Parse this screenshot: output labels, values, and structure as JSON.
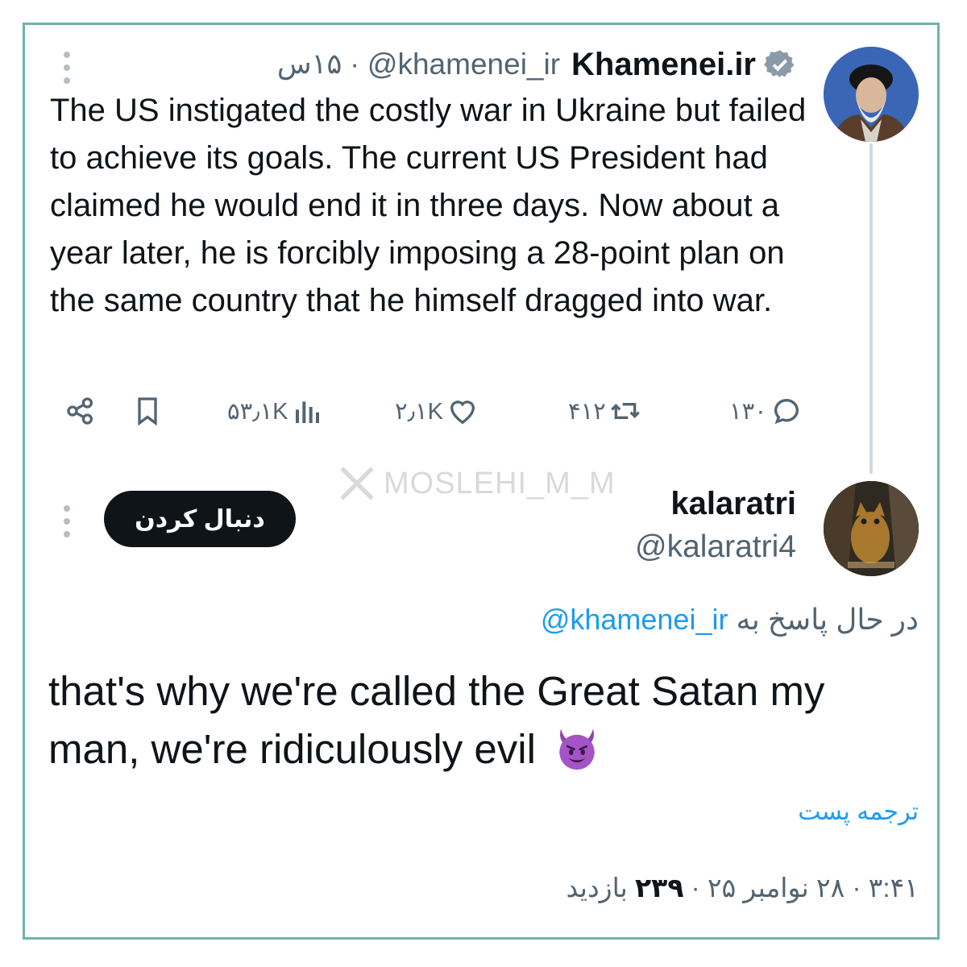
{
  "tweet": {
    "display_name": "Khamenei.ir",
    "handle": "@khamenei_ir",
    "separator": "·",
    "time": "۱۵س",
    "text": "The US instigated the costly war in Ukraine but failed to achieve its goals. The current US President had claimed he would end it in three days. Now about a year later, he is forcibly imposing a 28-point plan on the same country that he himself dragged into war.",
    "actions": {
      "replies": "۱۳۰",
      "reposts": "۴۱۲",
      "likes": "۲٫۱K",
      "views": "۵۳٫۱K"
    }
  },
  "watermark": "MOSLEHI_M_M",
  "reply": {
    "display_name": "kalaratri",
    "handle": "@kalaratri4",
    "follow_label": "دنبال کردن",
    "replying_to_prefix": "در حال پاسخ به",
    "replying_to_handle": "@khamenei_ir",
    "text": "that's why we're called the Great Satan my man,  we're ridiculously evil",
    "translate_label": "ترجمه پست",
    "time": "۳:۴۱",
    "date": "۲۸ نوامبر ۲۵",
    "views_count": "۲۳۹",
    "views_label": "بازدید",
    "separator": "·"
  },
  "colors": {
    "frame_border": "#6fb3a8",
    "link_blue": "#1d9bf0",
    "muted_gray": "#536471",
    "text_dark": "#0f1419"
  }
}
